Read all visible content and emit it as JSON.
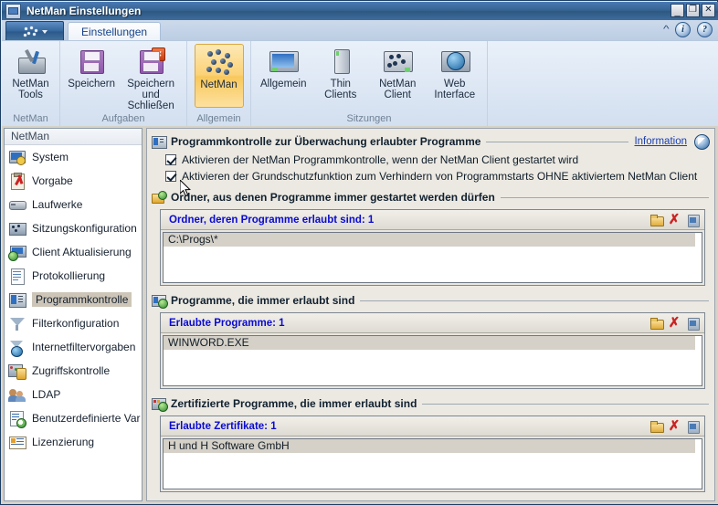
{
  "window": {
    "title": "NetMan Einstellungen",
    "icon": "app-window-icon",
    "controls": {
      "minimize": "_",
      "maximize": "❐",
      "close": "✕"
    }
  },
  "ribbon": {
    "app_button": "netman-orb",
    "tabs": [
      {
        "label": "Einstellungen",
        "active": true
      }
    ],
    "right_icons": [
      "collapse-chevron-icon",
      "information-icon",
      "help-icon"
    ],
    "collapse_glyph": "^",
    "info_glyph": "i",
    "help_glyph": "?",
    "groups": [
      {
        "label": "NetMan",
        "items": [
          {
            "label": "NetMan\nTools",
            "line1": "NetMan",
            "line2": "Tools",
            "icon": "netman-tools-icon",
            "selected": false
          }
        ]
      },
      {
        "label": "Aufgaben",
        "items": [
          {
            "line1": "Speichern",
            "line2": "",
            "icon": "save-icon",
            "selected": false
          },
          {
            "line1": "Speichern",
            "line2": "und Schließen",
            "icon": "save-and-close-icon",
            "selected": false
          }
        ]
      },
      {
        "label": "Allgemein",
        "items": [
          {
            "line1": "NetMan",
            "line2": "",
            "icon": "netman-icon",
            "selected": true
          }
        ]
      },
      {
        "label": "Sitzungen",
        "items": [
          {
            "line1": "Allgemein",
            "line2": "",
            "icon": "monitor-icon",
            "selected": false
          },
          {
            "line1": "Thin",
            "line2": "Clients",
            "icon": "thin-client-icon",
            "selected": false
          },
          {
            "line1": "NetMan",
            "line2": "Client",
            "icon": "netman-client-icon",
            "selected": false
          },
          {
            "line1": "Web",
            "line2": "Interface",
            "icon": "web-interface-icon",
            "selected": false
          }
        ]
      }
    ]
  },
  "sidebar": {
    "header": "NetMan",
    "items": [
      {
        "label": "System",
        "icon": "system-icon",
        "active": false
      },
      {
        "label": "Vorgabe",
        "icon": "clipboard-check-icon",
        "active": false
      },
      {
        "label": "Laufwerke",
        "icon": "drive-icon",
        "active": false
      },
      {
        "label": "Sitzungskonfiguration",
        "icon": "session-config-icon",
        "active": false
      },
      {
        "label": "Client Aktualisierung",
        "icon": "client-update-icon",
        "active": false
      },
      {
        "label": "Protokollierung",
        "icon": "log-icon",
        "active": false
      },
      {
        "label": "Programmkontrolle",
        "icon": "program-control-icon",
        "active": true
      },
      {
        "label": "Filterkonfiguration",
        "icon": "funnel-icon",
        "active": false
      },
      {
        "label": "Internetfiltervorgaben",
        "icon": "globe-icon",
        "active": false
      },
      {
        "label": "Zugriffskontrolle",
        "icon": "access-control-icon",
        "active": false
      },
      {
        "label": "LDAP",
        "icon": "ldap-users-icon",
        "active": false
      },
      {
        "label": "Benutzerdefinierte Var…",
        "icon": "variables-icon",
        "active": false
      },
      {
        "label": "Lizenzierung",
        "icon": "license-icon",
        "active": false
      }
    ]
  },
  "main": {
    "section1": {
      "title": "Programmkontrolle zur Überwachung erlaubter Programme",
      "icon": "program-control-icon",
      "info_link": "Information",
      "info_icon": "info-ball-icon",
      "checkboxes": [
        {
          "label": "Aktivieren der NetMan Programmkontrolle, wenn der NetMan Client gestartet wird",
          "checked": true
        },
        {
          "label": "Aktivieren der Grundschutzfunktion zum Verhindern von Programmstarts OHNE aktiviertem NetMan Client",
          "checked": true
        }
      ]
    },
    "section2": {
      "title": "Ordner, aus denen Programme immer gestartet werden dürfen",
      "icon": "folder-allow-icon",
      "panel_title": "Ordner, deren Programme erlaubt sind: 1",
      "buttons": [
        "new-icon",
        "delete-icon",
        "properties-icon"
      ],
      "delete_glyph": "✗",
      "rows": [
        "C:\\Progs\\*"
      ]
    },
    "section3": {
      "title": "Programme, die immer erlaubt sind",
      "icon": "program-allow-icon",
      "panel_title": "Erlaubte Programme: 1",
      "buttons": [
        "new-icon",
        "delete-icon",
        "properties-icon"
      ],
      "delete_glyph": "✗",
      "rows": [
        "WINWORD.EXE"
      ]
    },
    "section4": {
      "title": "Zertifizierte Programme, die immer erlaubt sind",
      "icon": "certificate-allow-icon",
      "panel_title": "Erlaubte Zertifikate: 1",
      "buttons": [
        "new-icon",
        "delete-icon",
        "properties-icon"
      ],
      "delete_glyph": "✗",
      "rows": [
        "H und H Software GmbH"
      ]
    }
  },
  "colors": {
    "title_bar": "#35628f",
    "panel_title_text": "#0a0ad1",
    "link": "#1a3fb0",
    "selection": "#d5d1c8",
    "ribbon_selected": "#f8c85c"
  }
}
